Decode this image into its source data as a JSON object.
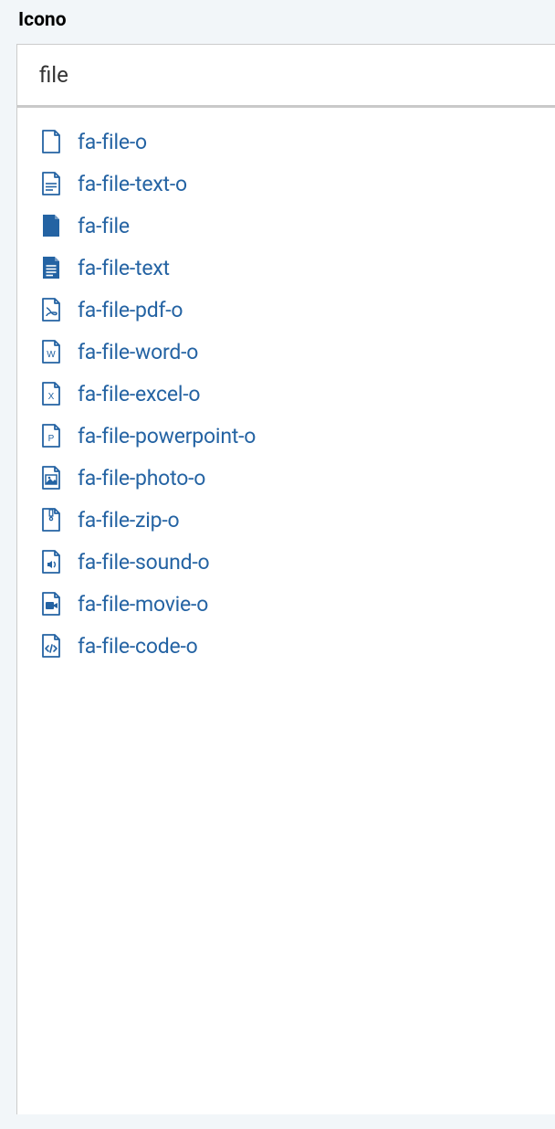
{
  "header": {
    "label": "Icono"
  },
  "search": {
    "value": "file"
  },
  "results": [
    {
      "icon": "file-o",
      "label": "fa-file-o"
    },
    {
      "icon": "file-text-o",
      "label": "fa-file-text-o"
    },
    {
      "icon": "file",
      "label": "fa-file"
    },
    {
      "icon": "file-text",
      "label": "fa-file-text"
    },
    {
      "icon": "file-pdf-o",
      "label": "fa-file-pdf-o"
    },
    {
      "icon": "file-word-o",
      "label": "fa-file-word-o"
    },
    {
      "icon": "file-excel-o",
      "label": "fa-file-excel-o"
    },
    {
      "icon": "file-powerpoint-o",
      "label": "fa-file-powerpoint-o"
    },
    {
      "icon": "file-photo-o",
      "label": "fa-file-photo-o"
    },
    {
      "icon": "file-zip-o",
      "label": "fa-file-zip-o"
    },
    {
      "icon": "file-sound-o",
      "label": "fa-file-sound-o"
    },
    {
      "icon": "file-movie-o",
      "label": "fa-file-movie-o"
    },
    {
      "icon": "file-code-o",
      "label": "fa-file-code-o"
    }
  ]
}
